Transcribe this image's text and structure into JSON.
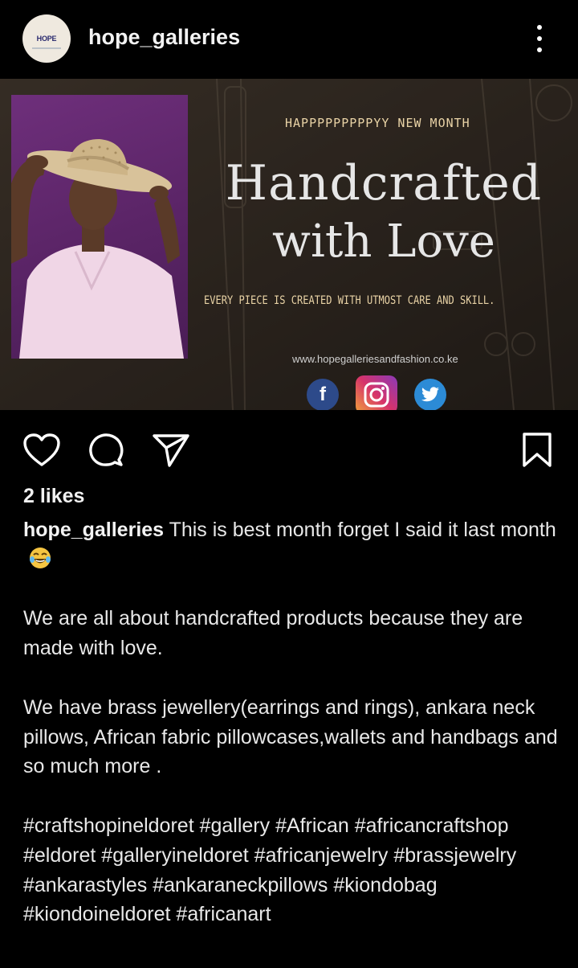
{
  "post": {
    "username": "hope_galleries",
    "avatar_text": "HOPE",
    "menu_icon": "more-vertical-icon"
  },
  "image": {
    "tagline": "HAPPPPPPPPPYY NEW MONTH",
    "headline_line1": "Handcrafted",
    "headline_line2": "with Love",
    "subline": "EVERY PIECE IS CREATED WITH UTMOST CARE AND SKILL.",
    "website": "www.hopegalleriesandfashion.co.ke",
    "social_icons": [
      "facebook-icon",
      "instagram-icon",
      "twitter-icon"
    ],
    "facebook_glyph": "f"
  },
  "actions": {
    "like_icon": "heart-icon",
    "comment_icon": "comment-icon",
    "share_icon": "send-icon",
    "save_icon": "bookmark-icon"
  },
  "likes": "2 likes",
  "caption": {
    "username": "hope_galleries",
    "line1": "This is best month forget I said it last month",
    "emoji": "laughing-emoji",
    "para2": "We are all about handcrafted products because they are made with love.",
    "para3": "We have brass jewellery(earrings and rings), ankara neck pillows, African fabric pillowcases,wallets and handbags and so much more .",
    "hashtags": "#craftshopineldoret #gallery #African #africancraftshop #eldoret #galleryineldoret #africanjewelry #brassjewelry #ankarastyles #ankaraneckpillows #kiondobag #kiondoineldoret #africanart"
  },
  "colors": {
    "background": "#000000",
    "text": "#e8e8e8",
    "image_accent": "#e9d3a6"
  }
}
